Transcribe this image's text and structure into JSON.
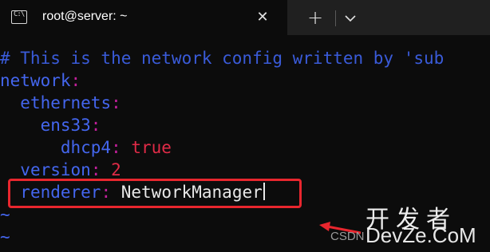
{
  "window": {
    "tab_title": "root@server: ~",
    "tab_icon": "terminal-icon",
    "close_icon": "close-icon",
    "new_tab_icon": "plus-icon",
    "dropdown_icon": "chevron-down-icon"
  },
  "editor": {
    "comment": "# This is the network config written by 'sub",
    "lines": [
      {
        "indent": "",
        "key": "network",
        "colon": ":",
        "value": ""
      },
      {
        "indent": "  ",
        "key": "ethernets",
        "colon": ":",
        "value": ""
      },
      {
        "indent": "    ",
        "key": "ens33",
        "colon": ":",
        "value": ""
      },
      {
        "indent": "      ",
        "key": "dhcp4",
        "colon": ":",
        "value": " true"
      },
      {
        "indent": "  ",
        "key": "version",
        "colon": ":",
        "value": " 2"
      },
      {
        "indent": "  ",
        "key": "renderer",
        "colon": ":",
        "value": " NetworkManager"
      }
    ],
    "empty_line_marker": "~"
  },
  "watermark": {
    "chinese": "开发者",
    "csdn": "CSDN",
    "devze": "DevZe.CoM"
  },
  "colors": {
    "background": "#0c0c0c",
    "titlebar": "#202020",
    "comment": "#3a5bd9",
    "key": "#4466ee",
    "colon": "#c2209a",
    "value_bool": "#e02b47",
    "value_text": "#e8e8e8",
    "annotation": "#e8262e"
  }
}
